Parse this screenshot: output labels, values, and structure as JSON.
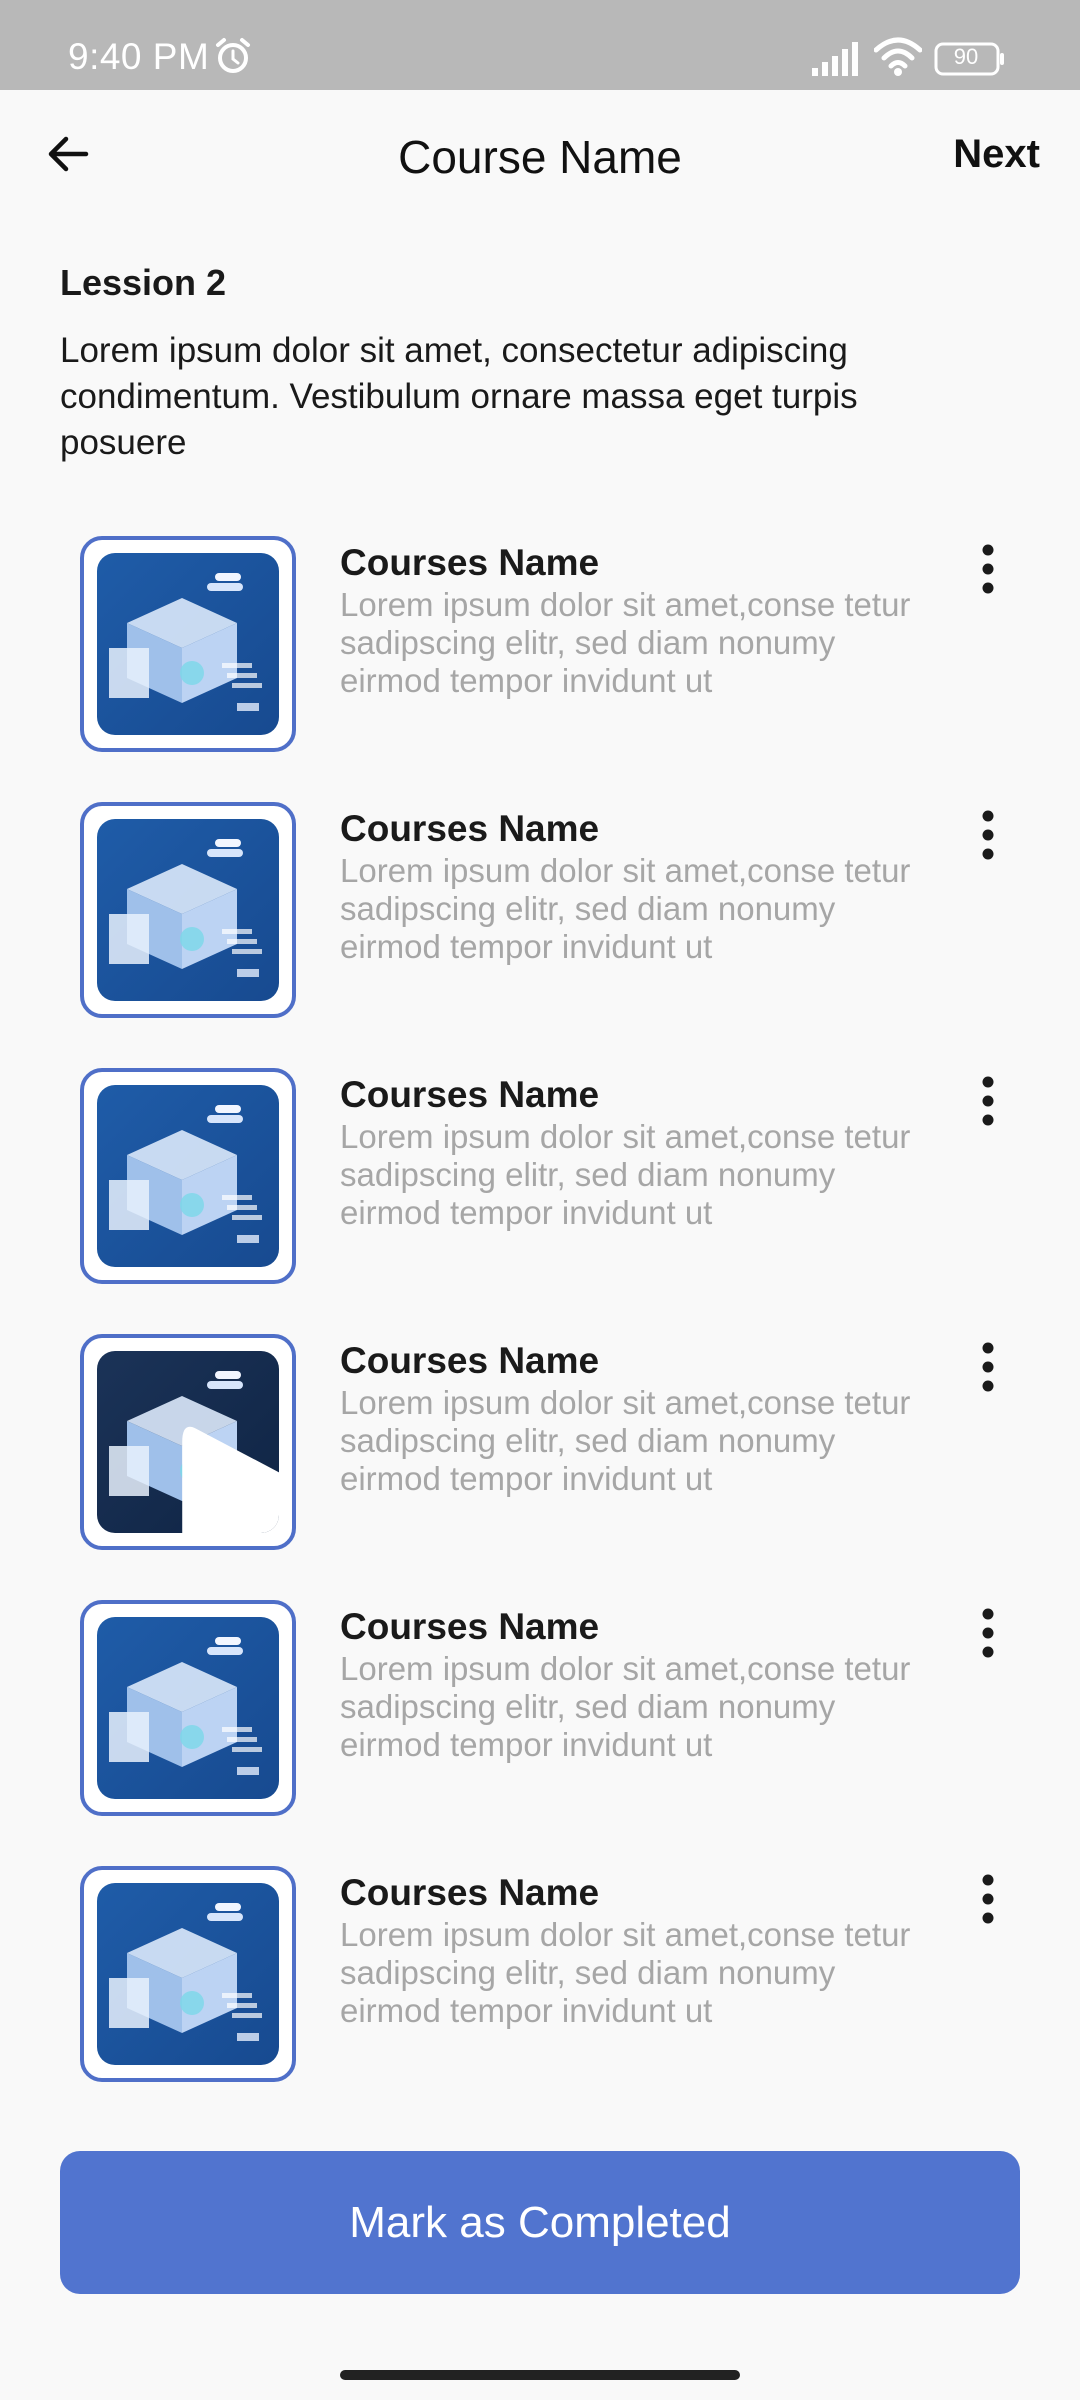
{
  "status_bar": {
    "time": "9:40 PM",
    "battery": "90",
    "icons": [
      "alarm-icon",
      "signal-icon",
      "wifi-icon",
      "battery-icon"
    ]
  },
  "header": {
    "back_icon": "arrow-left-icon",
    "title": "Course Name",
    "next_label": "Next"
  },
  "lesson": {
    "title": "Lession 2",
    "description": "Lorem ipsum dolor sit amet, consectetur adipiscing condimentum. Vestibulum ornare massa eget turpis posuere"
  },
  "courses": [
    {
      "name": "Courses Name",
      "description": "Lorem ipsum dolor sit amet,conse tetur sadipscing elitr, sed diam nonumy eirmod tempor invidunt ut",
      "playing": false
    },
    {
      "name": "Courses Name",
      "description": "Lorem ipsum dolor sit amet,conse tetur sadipscing elitr, sed diam nonumy eirmod tempor invidunt ut",
      "playing": false
    },
    {
      "name": "Courses Name",
      "description": "Lorem ipsum dolor sit amet,conse tetur sadipscing elitr, sed diam nonumy eirmod tempor invidunt ut",
      "playing": false
    },
    {
      "name": "Courses Name",
      "description": "Lorem ipsum dolor sit amet,conse tetur sadipscing elitr, sed diam nonumy eirmod tempor invidunt ut",
      "playing": true
    },
    {
      "name": "Courses Name",
      "description": "Lorem ipsum dolor sit amet,conse tetur sadipscing elitr, sed diam nonumy eirmod tempor invidunt ut",
      "playing": false
    },
    {
      "name": "Courses Name",
      "description": "Lorem ipsum dolor sit amet,conse tetur sadipscing elitr, sed diam nonumy eirmod tempor invidunt ut",
      "playing": false
    }
  ],
  "footer": {
    "complete_label": "Mark as Completed"
  },
  "colors": {
    "accent": "#5174cf",
    "thumb_border": "#4f6fc8",
    "muted_text": "#a6a6a6"
  }
}
